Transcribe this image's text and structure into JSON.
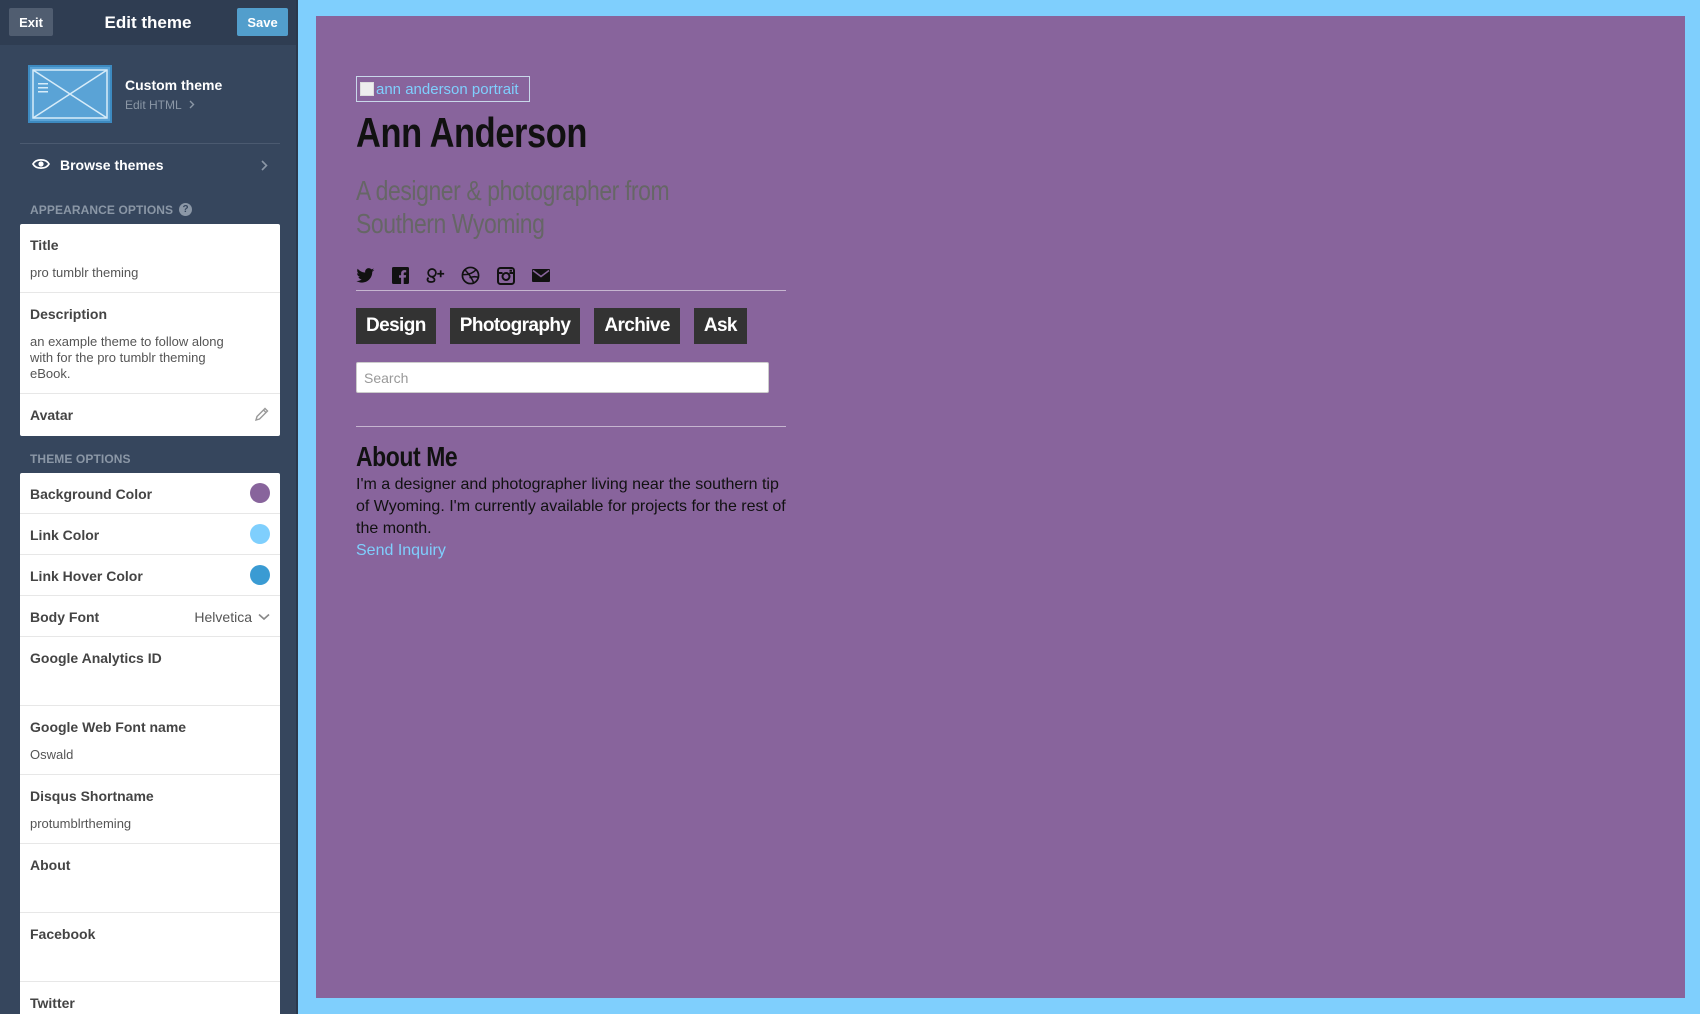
{
  "header": {
    "exit_label": "Exit",
    "title": "Edit theme",
    "save_label": "Save"
  },
  "custom_theme": {
    "name": "Custom theme",
    "edit_label": "Edit HTML"
  },
  "browse": {
    "label": "Browse themes"
  },
  "appearance": {
    "section_label": "APPEARANCE OPTIONS",
    "help_glyph": "?",
    "title_label": "Title",
    "title_value": "pro tumblr theming",
    "description_label": "Description",
    "description_value": "an example theme to follow along with for the pro tumblr theming eBook.",
    "avatar_label": "Avatar"
  },
  "theme_options": {
    "section_label": "THEME OPTIONS",
    "background_color_label": "Background Color",
    "background_color": "#88649c",
    "link_color_label": "Link Color",
    "link_color": "#7fcffd",
    "link_hover_color_label": "Link Hover Color",
    "link_hover_color": "#3a9bd3",
    "body_font_label": "Body Font",
    "body_font_value": "Helvetica",
    "ga_label": "Google Analytics ID",
    "ga_value": "",
    "gwf_label": "Google Web Font name",
    "gwf_value": "Oswald",
    "disqus_label": "Disqus Shortname",
    "disqus_value": "protumblrtheming",
    "about_label": "About",
    "about_value": "",
    "facebook_label": "Facebook",
    "facebook_value": "",
    "twitter_label": "Twitter"
  },
  "preview": {
    "portrait_alt": "ann anderson portrait",
    "site_title": "Ann Anderson",
    "site_description": "A designer & photographer from Southern Wyoming",
    "social_icons": [
      "twitter-icon",
      "facebook-icon",
      "google-plus-icon",
      "dribbble-icon",
      "instagram-icon",
      "email-icon"
    ],
    "nav": [
      "Design",
      "Photography",
      "Archive",
      "Ask"
    ],
    "search_placeholder": "Search",
    "about_title": "About Me",
    "about_text": "I'm a designer and photographer living near the southern tip of Wyoming. I'm currently available for projects for the rest of the month.",
    "send_inquiry": "Send Inquiry"
  }
}
